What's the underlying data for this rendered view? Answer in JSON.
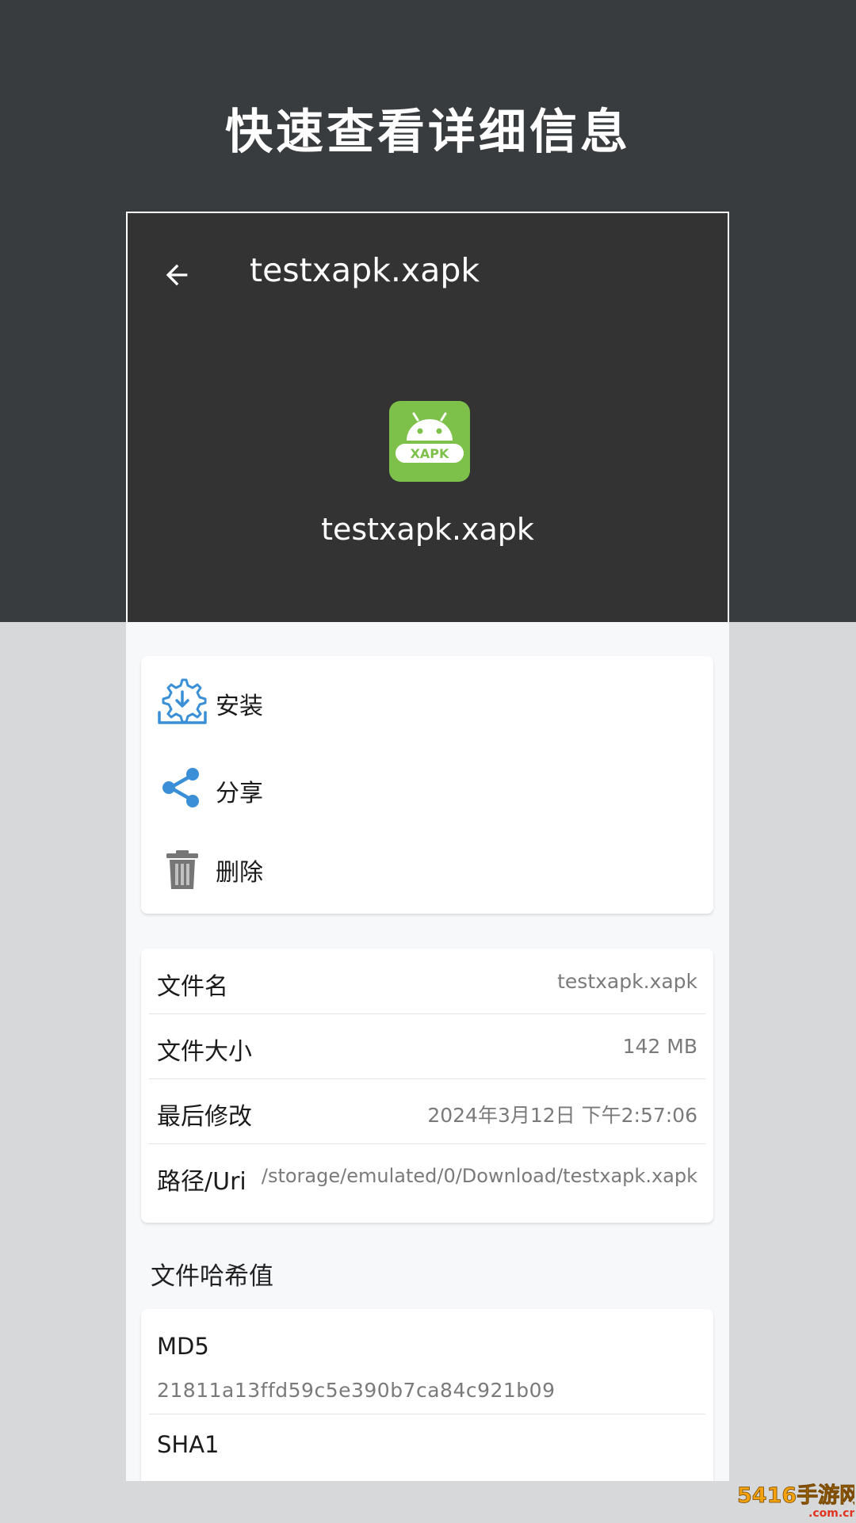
{
  "promo": {
    "title": "快速查看详细信息"
  },
  "toolbar": {
    "back_icon": "arrow-left-icon",
    "title": "testxapk.xapk"
  },
  "header": {
    "app_icon": "android-xapk-icon",
    "app_icon_text": "XAPK",
    "filename": "testxapk.xapk"
  },
  "actions": [
    {
      "icon": "install-gear-download-icon",
      "label": "安装"
    },
    {
      "icon": "share-icon",
      "label": "分享"
    },
    {
      "icon": "trash-icon",
      "label": "删除"
    }
  ],
  "file_info": [
    {
      "label": "文件名",
      "value": "testxapk.xapk"
    },
    {
      "label": "文件大小",
      "value": "142 MB"
    },
    {
      "label": "最后修改",
      "value": "2024年3月12日 下午2:57:06"
    },
    {
      "label": "路径/Uri",
      "value": "/storage/emulated/0/Download/testxapk.xapk"
    }
  ],
  "hash_section": {
    "title": "文件哈希值",
    "items": [
      {
        "label": "MD5",
        "value": "21811a13ffd59c5e390b7ca84c921b09"
      },
      {
        "label": "SHA1",
        "value": ""
      }
    ]
  },
  "watermark": {
    "text": "5416手游网",
    "domain": ".com.cn"
  },
  "colors": {
    "dark_band": "#393c3e",
    "header_bg": "#333334",
    "app_icon_green": "#7dc04a",
    "accent_blue": "#3a8fd6",
    "trash_gray": "#767676"
  }
}
